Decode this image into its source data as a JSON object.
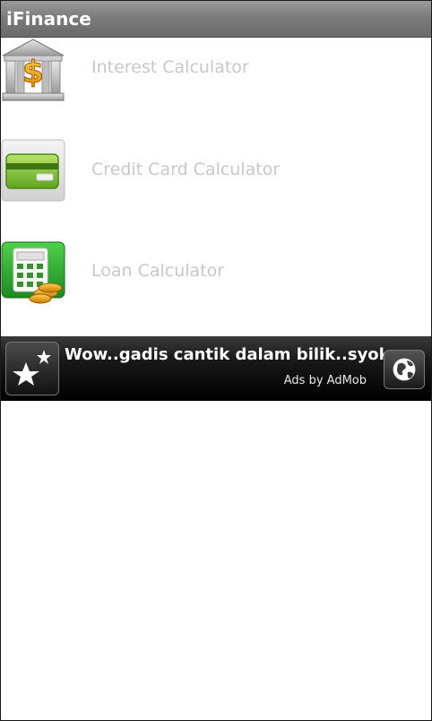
{
  "app": {
    "title": "iFinance"
  },
  "menu": {
    "items": [
      {
        "label": "Interest Calculator",
        "icon": "bank-dollar-icon"
      },
      {
        "label": "Credit Card Calculator",
        "icon": "credit-card-icon"
      },
      {
        "label": "Loan Calculator",
        "icon": "calculator-coins-icon"
      }
    ]
  },
  "ad": {
    "headline": "Wow..gadis cantik dalam bilik..syok",
    "attribution": "Ads by AdMob",
    "left_icon": "star-sparkle-icon",
    "right_icon": "globe-icon"
  },
  "colors": {
    "title_bar": "#7c7c7c",
    "menu_label": "#c8c8c8",
    "ad_background": "#000000"
  }
}
